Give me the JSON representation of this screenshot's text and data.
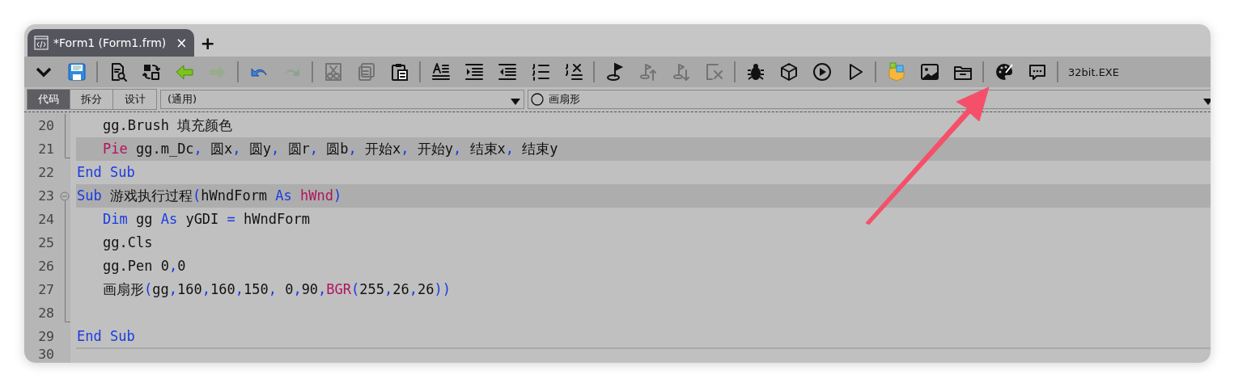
{
  "tabs": [
    {
      "label": "*Form1 (Form1.frm)",
      "close": "×",
      "selected": true
    }
  ],
  "new_tab": "+",
  "toolbar": {
    "groups": [
      [
        {
          "disabled": false
        },
        {
          "disabled": false
        }
      ],
      [
        {
          "disabled": false
        },
        {
          "disabled": false
        },
        {
          "disabled": false
        },
        {
          "disabled": true
        }
      ],
      [
        {
          "disabled": false
        },
        {
          "disabled": true
        }
      ],
      [
        {
          "disabled": true
        },
        {
          "disabled": true
        },
        {
          "disabled": false
        }
      ],
      [
        {
          "disabled": false
        },
        {
          "disabled": false
        },
        {
          "disabled": false
        },
        {
          "disabled": false
        },
        {
          "disabled": false
        }
      ],
      [
        {
          "disabled": false
        },
        {
          "disabled": true
        },
        {
          "disabled": true
        },
        {
          "disabled": true
        }
      ],
      [
        {
          "disabled": false
        },
        {
          "disabled": false
        },
        {
          "disabled": false
        },
        {
          "disabled": false
        }
      ],
      [
        {
          "disabled": false
        },
        {
          "disabled": false
        },
        {
          "disabled": false
        }
      ],
      [
        {
          "disabled": false
        },
        {
          "disabled": false
        }
      ]
    ],
    "target": "32bit.EXE"
  },
  "view_tabs": [
    {
      "label": "代码",
      "selected": true
    },
    {
      "label": "拆分",
      "selected": false
    },
    {
      "label": "设计",
      "selected": false
    }
  ],
  "object_dropdown": {
    "value": "(通用)"
  },
  "procedure_dropdown": {
    "value": "画扇形"
  },
  "code": [
    {
      "number": "20",
      "kind": "guide",
      "indented": true,
      "highlighted": false,
      "tokens": [
        {
          "text": "gg.Brush 填充颜色",
          "kind": "text"
        }
      ]
    },
    {
      "number": "21",
      "kind": "end",
      "indented": true,
      "highlighted": true,
      "tokens": [
        {
          "text": "Pie",
          "kind": "call"
        },
        {
          "text": " gg.m_Dc",
          "kind": "text"
        },
        {
          "text": ",",
          "kind": "punct"
        },
        {
          "text": " 圆x",
          "kind": "text"
        },
        {
          "text": ",",
          "kind": "punct"
        },
        {
          "text": " 圆y",
          "kind": "text"
        },
        {
          "text": ",",
          "kind": "punct"
        },
        {
          "text": " 圆r",
          "kind": "text"
        },
        {
          "text": ",",
          "kind": "punct"
        },
        {
          "text": " 圆b",
          "kind": "text"
        },
        {
          "text": ",",
          "kind": "punct"
        },
        {
          "text": " 开始x",
          "kind": "text"
        },
        {
          "text": ",",
          "kind": "punct"
        },
        {
          "text": " 开始y",
          "kind": "text"
        },
        {
          "text": ",",
          "kind": "punct"
        },
        {
          "text": " 结束x",
          "kind": "text"
        },
        {
          "text": ",",
          "kind": "punct"
        },
        {
          "text": " 结束y",
          "kind": "text"
        }
      ]
    },
    {
      "number": "22",
      "kind": "plain",
      "indented": false,
      "highlighted": false,
      "tokens": [
        {
          "text": "End Sub",
          "kind": "keyword"
        }
      ]
    },
    {
      "number": "23",
      "kind": "start",
      "indented": false,
      "highlighted": true,
      "tokens": [
        {
          "text": "Sub",
          "kind": "keyword"
        },
        {
          "text": " 游戏执行过程",
          "kind": "text"
        },
        {
          "text": "(",
          "kind": "punct"
        },
        {
          "text": "hWndForm ",
          "kind": "text"
        },
        {
          "text": "As",
          "kind": "keyword"
        },
        {
          "text": " hWnd",
          "kind": "call"
        },
        {
          "text": ")",
          "kind": "punct"
        }
      ]
    },
    {
      "number": "24",
      "kind": "guide",
      "indented": true,
      "highlighted": false,
      "tokens": [
        {
          "text": "Dim",
          "kind": "keyword"
        },
        {
          "text": " gg ",
          "kind": "text"
        },
        {
          "text": "As",
          "kind": "keyword"
        },
        {
          "text": " yGDI ",
          "kind": "text"
        },
        {
          "text": "=",
          "kind": "punct"
        },
        {
          "text": " hWndForm",
          "kind": "text"
        }
      ]
    },
    {
      "number": "25",
      "kind": "guide",
      "indented": true,
      "highlighted": false,
      "tokens": [
        {
          "text": "gg.Cls",
          "kind": "text"
        }
      ]
    },
    {
      "number": "26",
      "kind": "guide",
      "indented": true,
      "highlighted": false,
      "tokens": [
        {
          "text": "gg.Pen 0",
          "kind": "text"
        },
        {
          "text": ",",
          "kind": "punct"
        },
        {
          "text": "0",
          "kind": "text"
        }
      ]
    },
    {
      "number": "27",
      "kind": "guide",
      "indented": true,
      "highlighted": false,
      "tokens": [
        {
          "text": "画扇形",
          "kind": "text"
        },
        {
          "text": "(",
          "kind": "punct"
        },
        {
          "text": "gg",
          "kind": "text"
        },
        {
          "text": ",",
          "kind": "punct"
        },
        {
          "text": "160",
          "kind": "text"
        },
        {
          "text": ",",
          "kind": "punct"
        },
        {
          "text": "160",
          "kind": "text"
        },
        {
          "text": ",",
          "kind": "punct"
        },
        {
          "text": "150",
          "kind": "text"
        },
        {
          "text": ",",
          "kind": "punct"
        },
        {
          "text": " 0",
          "kind": "text"
        },
        {
          "text": ",",
          "kind": "punct"
        },
        {
          "text": "90",
          "kind": "text"
        },
        {
          "text": ",",
          "kind": "punct"
        },
        {
          "text": "BGR",
          "kind": "call"
        },
        {
          "text": "(",
          "kind": "punct"
        },
        {
          "text": "255",
          "kind": "text"
        },
        {
          "text": ",",
          "kind": "punct"
        },
        {
          "text": "26",
          "kind": "text"
        },
        {
          "text": ",",
          "kind": "punct"
        },
        {
          "text": "26",
          "kind": "text"
        },
        {
          "text": "))",
          "kind": "punct"
        }
      ]
    },
    {
      "number": "28",
      "kind": "end",
      "highlighted": false
    },
    {
      "number": "29",
      "kind": "plain",
      "indented": false,
      "highlighted": false,
      "tokens": [
        {
          "text": "End Sub",
          "kind": "keyword"
        }
      ]
    },
    {
      "number": "30",
      "kind": "plain",
      "highlighted": false
    }
  ]
}
